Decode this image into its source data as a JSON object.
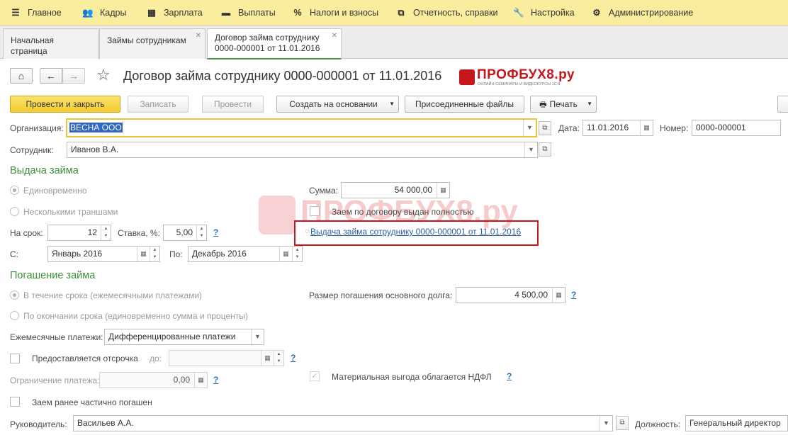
{
  "menu": [
    {
      "label": "Главное",
      "icon": "menu-icon"
    },
    {
      "label": "Кадры",
      "icon": "people-icon"
    },
    {
      "label": "Зарплата",
      "icon": "calculator-icon"
    },
    {
      "label": "Выплаты",
      "icon": "wallet-icon"
    },
    {
      "label": "Налоги и взносы",
      "icon": "percent-icon"
    },
    {
      "label": "Отчетность, справки",
      "icon": "reports-icon"
    },
    {
      "label": "Настройка",
      "icon": "wrench-icon"
    },
    {
      "label": "Администрирование",
      "icon": "gear-icon"
    }
  ],
  "tabs": [
    {
      "label": "Начальная страница"
    },
    {
      "label": "Займы сотрудникам"
    },
    {
      "label": "Договор займа сотруднику 0000-000001 от 11.01.2016"
    }
  ],
  "form": {
    "title": "Договор займа сотруднику 0000-000001 от 11.01.2016",
    "logo_text": "ПРОФБУХ8.ру",
    "logo_subtext": "ОНЛАЙН-СЕМИНАРЫ И ВИДЕОКУРСЫ 1С:8",
    "watermark": "ПРОФБУХ8.ру"
  },
  "toolbar": {
    "post_close": "Провести и закрыть",
    "save": "Записать",
    "post": "Провести",
    "create_based": "Создать на основании",
    "attached_files": "Присоединенные файлы",
    "print": "Печать"
  },
  "header": {
    "org_label": "Организация:",
    "org_value": "ВЕСНА ООО",
    "date_label": "Дата:",
    "date_value": "11.01.2016",
    "number_label": "Номер:",
    "number_value": "0000-000001",
    "employee_label": "Сотрудник:",
    "employee_value": "Иванов В.А."
  },
  "issue": {
    "section": "Выдача займа",
    "once": "Единовременно",
    "tranches": "Несколькими траншами",
    "sum_label": "Сумма:",
    "sum_value": "54 000,00",
    "fully_issued": "Заем по договору выдан полностью",
    "issue_doc_link": "Выдача займа сотруднику 0000-000001 от 11.01.2016",
    "term_label": "На срок:",
    "term_value": "12",
    "rate_label": "Ставка, %:",
    "rate_value": "5,00",
    "help": "?",
    "from_label": "С:",
    "from_value": "Январь 2016",
    "to_label": "По:",
    "to_value": "Декабрь 2016"
  },
  "repay": {
    "section": "Погашение займа",
    "monthly": "В течение срока (ежемесячными платежами)",
    "at_end": "По окончании срока (единовременно сумма и проценты)",
    "principal_label": "Размер погашения основного долга:",
    "principal_value": "4 500,00",
    "monthly_payments_label": "Ежемесячные платежи:",
    "monthly_payments_value": "Дифференцированные платежи",
    "deferral_label": "Предоставляется отсрочка",
    "deferral_to_label": "до:",
    "limit_label": "Ограничение платежа:",
    "limit_value": "0,00",
    "material_benefit": "Материальная выгода облагается НДФЛ",
    "partially_repaid": "Заем ранее частично погашен",
    "help": "?"
  },
  "footer": {
    "head_label": "Руководитель:",
    "head_value": "Васильев А.А.",
    "position_label": "Должность:",
    "position_value": "Генеральный директор"
  },
  "colors": {
    "menu_bg": "#fbed9e",
    "primary_button": "#f4cc2e",
    "section_green": "#3b8f3b",
    "link_blue": "#2d5fa6",
    "highlight_red": "#c8161d"
  }
}
